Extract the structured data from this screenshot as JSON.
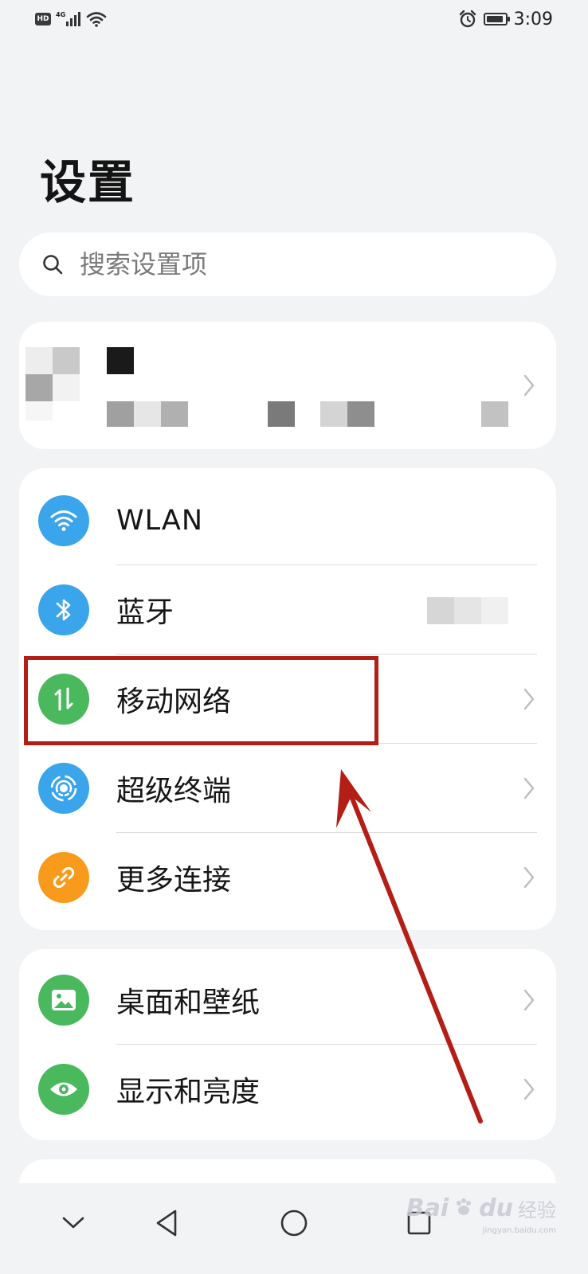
{
  "status_bar": {
    "hd_badge": "HD",
    "network_type": "4G",
    "time": "3:09",
    "battery_level": 0.9,
    "icons": [
      "hd-badge",
      "signal-icon",
      "wifi-icon",
      "alarm-icon",
      "battery-icon"
    ]
  },
  "page": {
    "title": "设置"
  },
  "search": {
    "placeholder": "搜索设置项",
    "icon": "search-icon"
  },
  "account_card": {
    "icon": "chevron-right-icon"
  },
  "connectivity": {
    "items": [
      {
        "label": "WLAN",
        "icon": "wifi-icon",
        "icon_color": "#3aa5ea"
      },
      {
        "label": "蓝牙",
        "icon": "bluetooth-icon",
        "icon_color": "#3aa5ea"
      },
      {
        "label": "移动网络",
        "icon": "mobile-data-icon",
        "icon_color": "#4ab85c"
      },
      {
        "label": "超级终端",
        "icon": "super-device-icon",
        "icon_color": "#3aa5ea"
      },
      {
        "label": "更多连接",
        "icon": "link-icon",
        "icon_color": "#f89b1c"
      }
    ]
  },
  "display": {
    "items": [
      {
        "label": "桌面和壁纸",
        "icon": "wallpaper-icon",
        "icon_color": "#4ab85c"
      },
      {
        "label": "显示和亮度",
        "icon": "eye-icon",
        "icon_color": "#4ab85c"
      }
    ]
  },
  "navigation": {
    "icons": [
      "collapse-icon",
      "back-icon",
      "home-icon",
      "recents-icon"
    ]
  },
  "watermark": {
    "brand": "Bai",
    "brand2": "du",
    "sub": "经验",
    "url": "jingyan.baidu.com"
  },
  "annotation": {
    "color": "#b31e16"
  }
}
